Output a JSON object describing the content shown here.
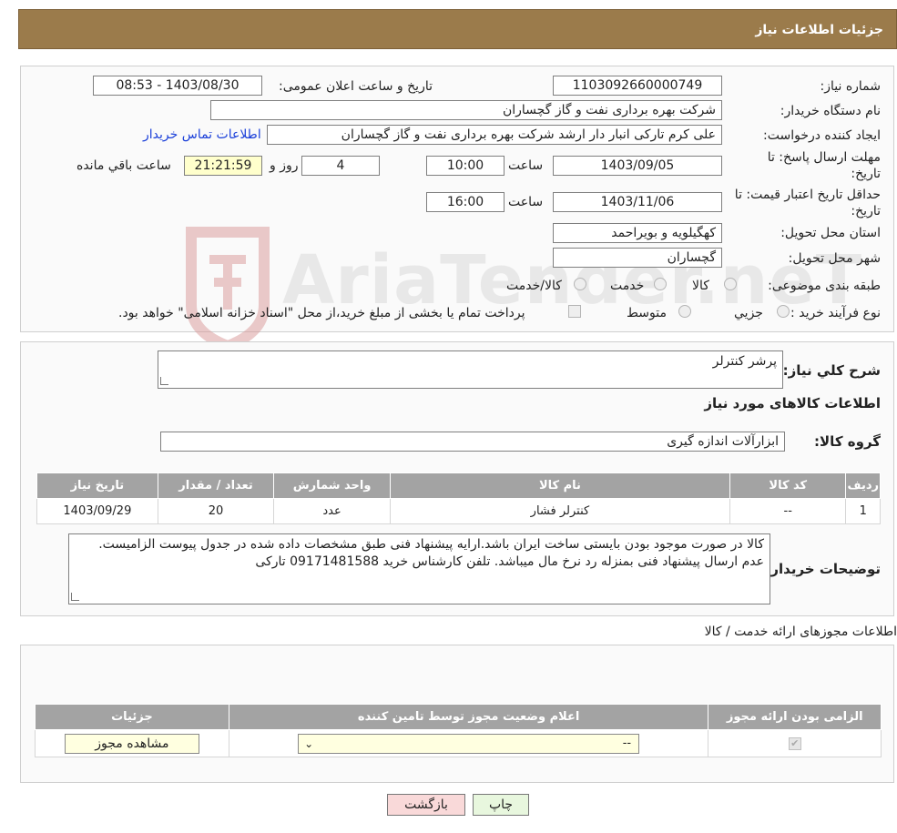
{
  "header": {
    "title": "جزئیات اطلاعات نیاز"
  },
  "info": {
    "need_number_label": "شماره نیاز:",
    "need_number": "1103092660000749",
    "announce_label": "تاریخ و ساعت اعلان عمومی:",
    "announce_value": "1403/08/30 - 08:53",
    "buyer_label": "نام دستگاه خریدار:",
    "buyer_value": "شرکت بهره برداری نفت و گاز گچساران",
    "creator_label": "ایجاد کننده درخواست:",
    "creator_value": "علی کرم تارکی انبار دار ارشد شرکت بهره برداری نفت و گاز گچساران",
    "contact_link": "اطلاعات تماس خریدار",
    "deadline_label_1": "مهلت ارسال پاسخ: تا",
    "deadline_label_2": "تاریخ:",
    "deadline_date": "1403/09/05",
    "time_label": "ساعت",
    "deadline_time": "10:00",
    "days_value": "4",
    "days_label": "روز و",
    "remaining_value": "21:21:59",
    "remaining_label": "ساعت باقي مانده",
    "validity_label_1": "حداقل تاریخ اعتبار قیمت: تا",
    "validity_label_2": "تاریخ:",
    "validity_date": "1403/11/06",
    "validity_time": "16:00",
    "province_label": "استان محل تحویل:",
    "province_value": "کهگیلویه و بویراحمد",
    "city_label": "شهر محل تحویل:",
    "city_value": "گچساران",
    "category_label": "طبقه بندی موضوعی:",
    "category_options": [
      "کالا",
      "خدمت",
      "کالا/خدمت"
    ],
    "process_label": "نوع فرآیند خرید :",
    "process_options": [
      "جزیي",
      "متوسط"
    ],
    "payment_note": "پرداخت تمام یا بخشی از مبلغ خرید،از محل \"اسناد خزانه اسلامی\" خواهد بود."
  },
  "watermark": {
    "brand": "AriaTender.neT"
  },
  "summary": {
    "label": "شرح كلي نياز:",
    "value": "پرشر کنترلر",
    "goods_title": "اطلاعات کالاهای مورد نیاز",
    "group_label": "گروه کالا:",
    "group_value": "ابزارآلات اندازه گیری"
  },
  "items_table": {
    "headers": [
      "رديف",
      "کد کالا",
      "نام کالا",
      "واحد شمارش",
      "تعداد / مقدار",
      "تاریخ نیاز"
    ],
    "rows": [
      [
        "1",
        "--",
        "کنترلر فشار",
        "عدد",
        "20",
        "1403/09/29"
      ]
    ]
  },
  "buyer_notes": {
    "label": "توضیحات خریدار:",
    "text": "کالا در صورت موجود بودن بایستی ساخت ایران باشد.ارایه پیشنهاد فنی طبق مشخصات داده شده در جدول پیوست الزامیست. عدم ارسال پیشنهاد فنی بمنزله رد نرخ مال میباشد. تلفن کارشناس خرید 09171481588 تارکی"
  },
  "licenses": {
    "title": "اطلاعات مجوزهای ارائه خدمت / کالا",
    "headers": [
      "الزامی بودن ارائه مجوز",
      "اعلام وضعیت مجوز توسط تامین کننده",
      "جزئیات"
    ],
    "select_value": "--",
    "view_button": "مشاهده مجوز"
  },
  "buttons": {
    "print": "چاپ",
    "back": "بازگشت"
  },
  "colors": {
    "header_bg": "#9b7b4b",
    "table_header_bg": "#a3a3a3",
    "back_btn_bg": "#f9d9d9",
    "print_btn_bg": "#e8f7de"
  }
}
